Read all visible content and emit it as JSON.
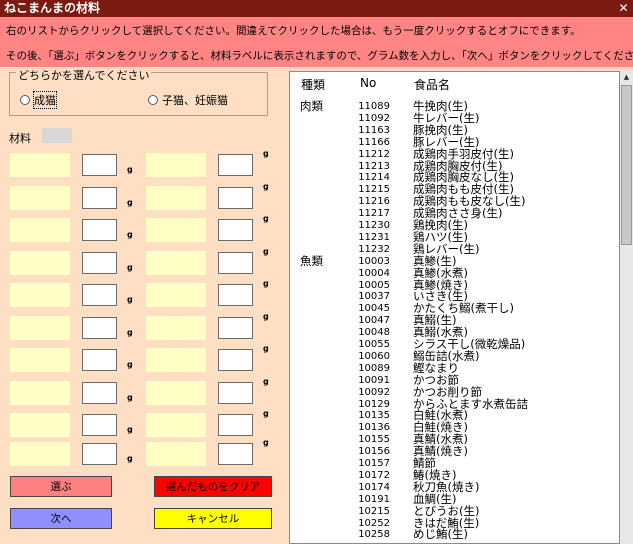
{
  "title": "ねこまんまの材料",
  "close_glyph": "✕",
  "instructions": {
    "line1": "右のリストからクリックして選択してください。間違えてクリックした場合は、もう一度クリックするとオフにできます。",
    "line2": "その後、「選ぶ」ボタンをクリックすると、材料ラベルに表示されますので、グラム数を入力し、「次へ」ボタンをクリックしてください。"
  },
  "selector": {
    "legend": "どちらかを選んでください",
    "options": [
      {
        "label": "成猫",
        "selected": true
      },
      {
        "label": "子猫、妊娠猫",
        "selected": false
      }
    ]
  },
  "materials": {
    "label": "材料",
    "unit": "g",
    "rows": [
      {
        "left_grams": "",
        "right_grams": ""
      },
      {
        "left_grams": "",
        "right_grams": ""
      },
      {
        "left_grams": "",
        "right_grams": ""
      },
      {
        "left_grams": "",
        "right_grams": ""
      },
      {
        "left_grams": "",
        "right_grams": ""
      },
      {
        "left_grams": "",
        "right_grams": ""
      },
      {
        "left_grams": "",
        "right_grams": ""
      },
      {
        "left_grams": "",
        "right_grams": ""
      },
      {
        "left_grams": "",
        "right_grams": ""
      },
      {
        "left_grams": "",
        "right_grams": ""
      }
    ]
  },
  "buttons": {
    "select": {
      "label": "選ぶ",
      "color": "#ff8080"
    },
    "clear": {
      "label": "選んだものをクリア",
      "color": "#ff0000"
    },
    "next": {
      "label": "次へ",
      "color": "#8f8fff"
    },
    "cancel": {
      "label": "キャンセル",
      "color": "#ffff00"
    }
  },
  "food_list": {
    "headers": {
      "category": "種類",
      "no": "No",
      "name": "食品名"
    },
    "rows": [
      {
        "category": "肉類",
        "no": "11089",
        "name": "牛挽肉(生)"
      },
      {
        "category": "",
        "no": "11092",
        "name": "牛レバー(生)"
      },
      {
        "category": "",
        "no": "11163",
        "name": "豚挽肉(生)"
      },
      {
        "category": "",
        "no": "11166",
        "name": "豚レバー(生)"
      },
      {
        "category": "",
        "no": "11212",
        "name": "成鶏肉手羽皮付(生)"
      },
      {
        "category": "",
        "no": "11213",
        "name": "成鶏肉胸皮付(生)"
      },
      {
        "category": "",
        "no": "11214",
        "name": "成鶏肉胸皮なし(生)"
      },
      {
        "category": "",
        "no": "11215",
        "name": "成鶏肉もも皮付(生)"
      },
      {
        "category": "",
        "no": "11216",
        "name": "成鶏肉もも皮なし(生)"
      },
      {
        "category": "",
        "no": "11217",
        "name": "成鶏肉ささ身(生)"
      },
      {
        "category": "",
        "no": "11230",
        "name": "鶏挽肉(生)"
      },
      {
        "category": "",
        "no": "11231",
        "name": "鶏ハツ(生)"
      },
      {
        "category": "",
        "no": "11232",
        "name": "鶏レバー(生)"
      },
      {
        "category": "魚類",
        "no": "10003",
        "name": "真鯵(生)"
      },
      {
        "category": "",
        "no": "10004",
        "name": "真鯵(水煮)"
      },
      {
        "category": "",
        "no": "10005",
        "name": "真鯵(焼き)"
      },
      {
        "category": "",
        "no": "10037",
        "name": "いさき(生)"
      },
      {
        "category": "",
        "no": "10045",
        "name": "かたくち鰯(煮干し)"
      },
      {
        "category": "",
        "no": "10047",
        "name": "真鰯(生)"
      },
      {
        "category": "",
        "no": "10048",
        "name": "真鰯(水煮)"
      },
      {
        "category": "",
        "no": "10055",
        "name": "シラス干し(微乾燥品)"
      },
      {
        "category": "",
        "no": "10060",
        "name": "鰯缶詰(水煮)"
      },
      {
        "category": "",
        "no": "10089",
        "name": "鰹なまり"
      },
      {
        "category": "",
        "no": "10091",
        "name": "かつお節"
      },
      {
        "category": "",
        "no": "10092",
        "name": "かつお削り節"
      },
      {
        "category": "",
        "no": "10129",
        "name": "からふとます水煮缶詰"
      },
      {
        "category": "",
        "no": "10135",
        "name": "白鮭(水煮)"
      },
      {
        "category": "",
        "no": "10136",
        "name": "白鮭(焼き)"
      },
      {
        "category": "",
        "no": "10155",
        "name": "真鯖(水煮)"
      },
      {
        "category": "",
        "no": "10156",
        "name": "真鯖(焼き)"
      },
      {
        "category": "",
        "no": "10157",
        "name": "鯖節"
      },
      {
        "category": "",
        "no": "10172",
        "name": "鰆(焼き)"
      },
      {
        "category": "",
        "no": "10174",
        "name": "秋刀魚(焼き)"
      },
      {
        "category": "",
        "no": "10191",
        "name": "血鯛(生)"
      },
      {
        "category": "",
        "no": "10215",
        "name": "とびうお(生)"
      },
      {
        "category": "",
        "no": "10252",
        "name": "きはだ鮪(生)"
      },
      {
        "category": "",
        "no": "10258",
        "name": "めじ鮪(生)"
      }
    ]
  }
}
